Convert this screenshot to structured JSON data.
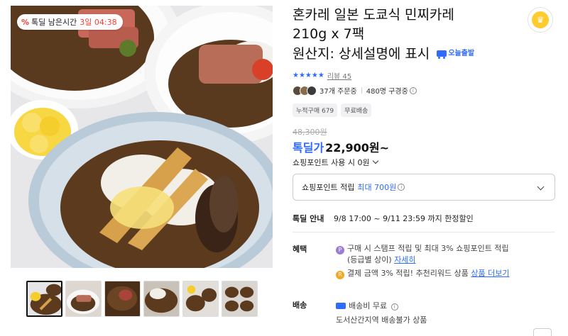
{
  "gallery": {
    "deal_badge": {
      "icon": "percent-icon",
      "label": "톡딜 남은시간",
      "time": "3일 04:38"
    },
    "thumbnails": 6,
    "selected_thumbnail": 1
  },
  "product": {
    "title_line1": "혼카레 일본 도쿄식 민찌카레",
    "title_line2": "210g x 7팩",
    "title_line3": "원산지: 상세설명에 표시",
    "today_badge": "오늘출발",
    "grade_badge_icon": "crown-badge-icon"
  },
  "rating": {
    "stars": "★★★★★",
    "review_text": "리뷰 45"
  },
  "buyers": {
    "orders": "37개 주문중",
    "subscribers": "480명 구경중"
  },
  "tags": [
    "누적구매 679",
    "무료배송"
  ],
  "price": {
    "original": "48,300원",
    "deal_label": "톡딜가",
    "deal_price": "22,900원~",
    "point_use": "쇼핑포인트 사용 시 0원"
  },
  "point_box": {
    "label": "쇼핑포인트 적립",
    "max": "최대 700원"
  },
  "deal_info": {
    "label": "톡딜 안내",
    "value": "9/8 17:00 ~ 9/11 23:59 까지 한정할인"
  },
  "benefits": {
    "label": "혜택",
    "item1_text": "구매 시 스탬프 적립 및 최대 3% 쇼핑포인트 적립",
    "item1_sub": "(등급별 상이)",
    "item1_link": "자세히",
    "item2_text": "결제 금액 3% 적립! 추천리워드 상품",
    "item2_link": "상품 더보기"
  },
  "shipping": {
    "label": "배송",
    "fee": "배송비 무료",
    "note": "도서산간지역 배송불가 상품"
  },
  "colors": {
    "accent": "#2f6bff",
    "deal_red": "#ff3b30"
  }
}
